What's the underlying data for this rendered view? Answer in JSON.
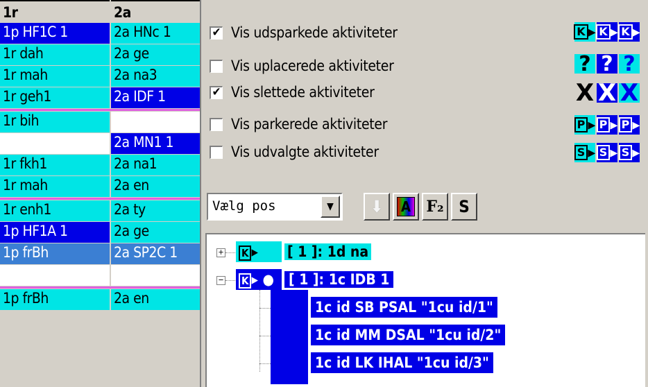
{
  "grid": {
    "headers": [
      "1r",
      "2a"
    ],
    "rows": [
      {
        "c1": "1p HF1C 1",
        "c2": "2a HNc  1"
      },
      {
        "c1": "1r dah",
        "c2": "2a ge"
      },
      {
        "c1": "1r mah",
        "c2": "2a na3"
      },
      {
        "c1": "1r geh1",
        "c2": "2a IDF  1"
      },
      {
        "c1": "1r bih",
        "c2": ""
      },
      {
        "c1": "",
        "c2": "2a MN1  1"
      },
      {
        "c1": "1r fkh1",
        "c2": "2a na1"
      },
      {
        "c1": "1r mah",
        "c2": "2a en"
      },
      {
        "c1": "1r enh1",
        "c2": "2a ty"
      },
      {
        "c1": "1p HF1A 1",
        "c2": "2a ge"
      },
      {
        "c1": "1p frBh",
        "c2": "2a SP2C 1"
      },
      {
        "c1": "",
        "c2": ""
      },
      {
        "c1": "1p frBh",
        "c2": "2a en"
      }
    ]
  },
  "options": [
    {
      "label": "Vis udsparkede aktiviteter",
      "checked": true
    },
    {
      "label": "Vis uplacerede aktiviteter",
      "checked": false
    },
    {
      "label": "Vis slettede aktiviteter",
      "checked": true
    },
    {
      "label": "Vis parkerede aktiviteter",
      "checked": false
    },
    {
      "label": "Vis udvalgte aktiviteter",
      "checked": false
    }
  ],
  "check_mark": "✔",
  "icon_letters": {
    "k": "K",
    "q": "?",
    "x": "X",
    "p": "P",
    "s": "S"
  },
  "toolbar": {
    "select_value": "Vælg pos",
    "f2_label": "F₂",
    "s_label": "S",
    "a_label": "A"
  },
  "tree": {
    "node1": "[ 1 ]: 1d na",
    "node2": "[ 1 ]: 1c IDB  1",
    "children": [
      "1c id SB PSAL \"1cu id/1\"",
      "1c id MM DSAL \"1cu id/2\"",
      "1c id LK IHAL \"1cu id/3\""
    ],
    "expand_plus": "+",
    "expand_minus": "−",
    "bullet": "●"
  },
  "colors": {
    "cyan": "#00e5e5",
    "blue": "#0000e6",
    "steel": "#3b7fd3",
    "pink": "#e060e0"
  }
}
